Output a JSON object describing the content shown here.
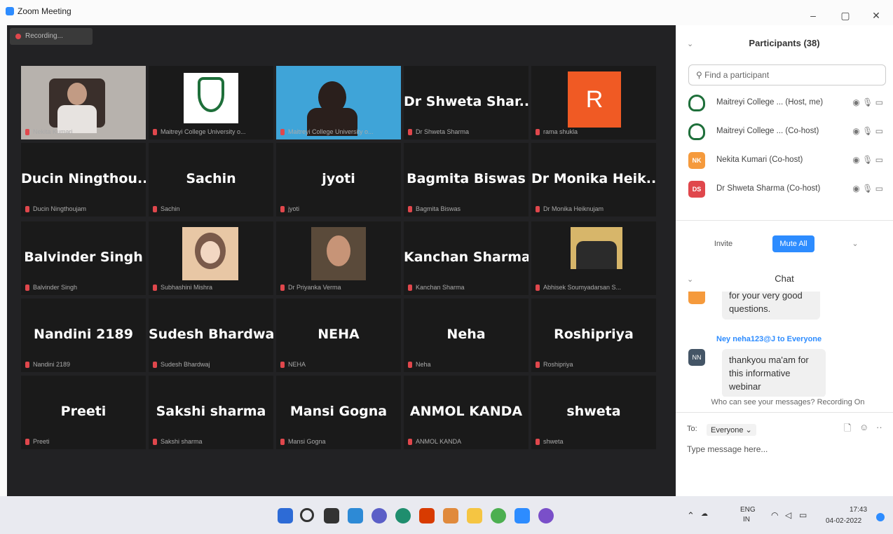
{
  "window": {
    "title": "Zoom Meeting",
    "minimize": "–",
    "maximize": "▢",
    "close": "✕"
  },
  "recording": {
    "label": "Recording..."
  },
  "tiles": [
    {
      "big": "",
      "label": "Nekita Kumari",
      "kind": "video-person",
      "active": true
    },
    {
      "big": "",
      "label": "Maitreyi College University o...",
      "kind": "logo"
    },
    {
      "big": "",
      "label": "Maitreyi College University o...",
      "kind": "video-person-blue"
    },
    {
      "big": "Dr Shweta Shar...",
      "label": "Dr Shweta Sharma",
      "kind": "text"
    },
    {
      "big": "R",
      "label": "rama shukla",
      "kind": "avatar-r"
    },
    {
      "big": "Ducin Ningthou...",
      "label": "Ducin Ningthoujam",
      "kind": "text"
    },
    {
      "big": "Sachin",
      "label": "Sachin",
      "kind": "text"
    },
    {
      "big": "jyoti",
      "label": "jyoti",
      "kind": "text"
    },
    {
      "big": "Bagmita Biswas",
      "label": "Bagmita Biswas",
      "kind": "text"
    },
    {
      "big": "Dr Monika Heik...",
      "label": "Dr Monika Heiknujam",
      "kind": "text"
    },
    {
      "big": "Balvinder Singh",
      "label": "Balvinder Singh",
      "kind": "text"
    },
    {
      "big": "",
      "label": "Subhashini Mishra",
      "kind": "pic-anime"
    },
    {
      "big": "",
      "label": "Dr Priyanka Verma",
      "kind": "pic-woman"
    },
    {
      "big": "Kanchan Sharma",
      "label": "Kanchan Sharma",
      "kind": "text"
    },
    {
      "big": "",
      "label": "Abhisek Soumyadarsan S...",
      "kind": "pic-group"
    },
    {
      "big": "Nandini 2189",
      "label": "Nandini 2189",
      "kind": "text"
    },
    {
      "big": "Sudesh Bhardwaj",
      "label": "Sudesh Bhardwaj",
      "kind": "text"
    },
    {
      "big": "NEHA",
      "label": "NEHA",
      "kind": "text"
    },
    {
      "big": "Neha",
      "label": "Neha",
      "kind": "text"
    },
    {
      "big": "Roshipriya",
      "label": "Roshipriya",
      "kind": "text"
    },
    {
      "big": "Preeti",
      "label": "Preeti",
      "kind": "text"
    },
    {
      "big": "Sakshi sharma",
      "label": "Sakshi sharma",
      "kind": "text"
    },
    {
      "big": "Mansi Gogna",
      "label": "Mansi Gogna",
      "kind": "text"
    },
    {
      "big": "ANMOL KANDA",
      "label": "ANMOL KANDA",
      "kind": "text"
    },
    {
      "big": "shweta",
      "label": "shweta",
      "kind": "text"
    }
  ],
  "participants": {
    "title": "Participants (38)",
    "search_placeholder": "Find a participant",
    "list": [
      {
        "name": "Maitreyi College ... (Host, me)",
        "avatar": "",
        "color": "#ffffff"
      },
      {
        "name": "Maitreyi College ... (Co-host)",
        "avatar": "",
        "color": "#ffffff"
      },
      {
        "name": "Nekita Kumari (Co-host)",
        "avatar": "NK",
        "color": "#f59a3c"
      },
      {
        "name": "Dr Shweta Sharma (Co-host)",
        "avatar": "DS",
        "color": "#e0474c"
      }
    ],
    "invite": "Invite",
    "mute_all": "Mute All"
  },
  "chat": {
    "title": "Chat",
    "msg1": "for your very good questions.",
    "sender2": "Ney neha123@J to Everyone",
    "sender2_avatar": "NN",
    "msg2": "thankyou ma'am for this informative webinar",
    "notice": "Who can see your messages? Recording On",
    "to_label": "To:",
    "to_value": "Everyone",
    "placeholder": "Type message here..."
  },
  "tray": {
    "lang1": "ENG",
    "lang2": "IN",
    "time": "17:43",
    "date": "04-02-2022"
  },
  "colors": {
    "accent": "#2d8cff",
    "mic_muted": "#e0474c",
    "active_border": "#e8e64a"
  }
}
